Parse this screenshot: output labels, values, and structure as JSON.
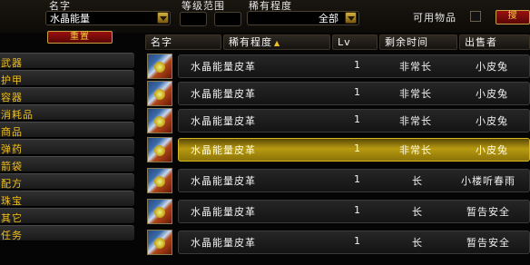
{
  "filters": {
    "name_label": "名字",
    "name_value": "水晶能量",
    "level_range_label": "等级范围",
    "rarity_label": "稀有程度",
    "rarity_value": "全部",
    "usable_label": "可用物品",
    "reset_label": "重置",
    "search_label": "搜"
  },
  "categories": [
    "武器",
    "护甲",
    "容器",
    "消耗品",
    "商品",
    "弹药",
    "箭袋",
    "配方",
    "珠宝",
    "其它",
    "任务"
  ],
  "columns": {
    "name": "名字",
    "rarity": "稀有程度",
    "level": "Lv",
    "time_left": "剩余时间",
    "seller": "出售者"
  },
  "rows": [
    {
      "icon": "leather-item-icon",
      "name": "水晶能量皮革",
      "level": "1",
      "time_left": "非常长",
      "seller": "小皮兔",
      "selected": false
    },
    {
      "icon": "leather-item-icon",
      "name": "水晶能量皮革",
      "level": "1",
      "time_left": "非常长",
      "seller": "小皮兔",
      "selected": false
    },
    {
      "icon": "leather-item-icon",
      "name": "水晶能量皮革",
      "level": "1",
      "time_left": "非常长",
      "seller": "小皮兔",
      "selected": false
    },
    {
      "icon": "leather-item-icon",
      "name": "水晶能量皮革",
      "level": "1",
      "time_left": "非常长",
      "seller": "小皮兔",
      "selected": true
    },
    {
      "icon": "leather-item-icon",
      "name": "水晶能量皮革",
      "level": "1",
      "time_left": "长",
      "seller": "小楼听春雨",
      "selected": false
    },
    {
      "icon": "leather-item-icon",
      "name": "水晶能量皮革",
      "level": "1",
      "time_left": "长",
      "seller": "暂告安全",
      "selected": false
    },
    {
      "icon": "leather-item-icon",
      "name": "水晶能量皮革",
      "level": "1",
      "time_left": "长",
      "seller": "暂告安全",
      "selected": false
    }
  ],
  "colors": {
    "label_gold": "#f2c22c",
    "selected_row": "#b89a10",
    "button_red": "#9a1010"
  }
}
